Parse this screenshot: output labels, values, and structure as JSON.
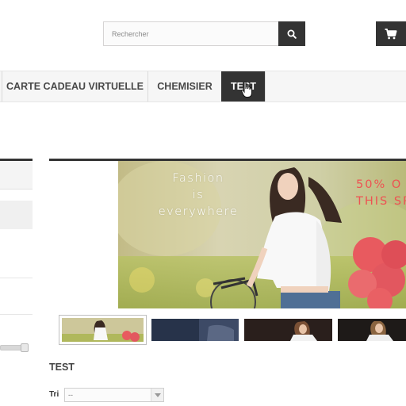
{
  "header": {
    "search_placeholder": "Rechercher",
    "search_button_icon": "search-icon",
    "cart_icon": "cart-icon"
  },
  "menu": {
    "items": [
      {
        "label": "CARTE CADEAU VIRTUELLE",
        "active": false
      },
      {
        "label": "CHEMISIER",
        "active": false
      },
      {
        "label": "TEST",
        "active": true
      }
    ]
  },
  "banner": {
    "text_left": [
      "Fashion",
      "is",
      "everywhere"
    ],
    "text_right": [
      "50% O",
      "THIS SP"
    ]
  },
  "category": {
    "title": "TEST",
    "sort_label": "Tri",
    "sort_selected": "--"
  },
  "colors": {
    "dark": "#333333",
    "accent_red": "#ee5252",
    "menu_bg": "#f6f6f6"
  }
}
